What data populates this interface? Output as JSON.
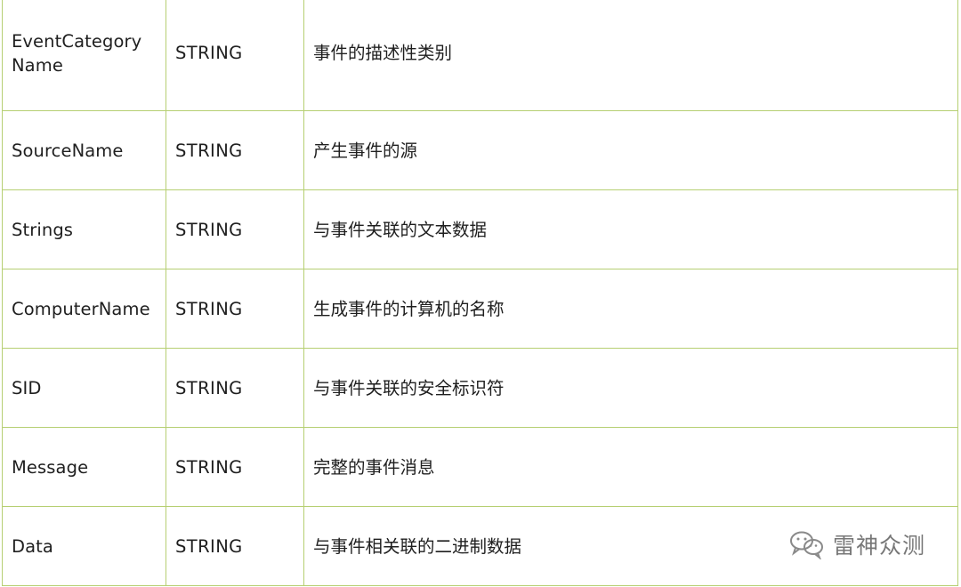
{
  "table": {
    "rows": [
      {
        "name": "EventCategoryName",
        "type": "STRING",
        "description": "事件的描述性类别"
      },
      {
        "name": "SourceName",
        "type": "STRING",
        "description": "产生事件的源"
      },
      {
        "name": "Strings",
        "type": "STRING",
        "description": "与事件关联的文本数据"
      },
      {
        "name": "ComputerName",
        "type": "STRING",
        "description": "生成事件的计算机的名称"
      },
      {
        "name": "SID",
        "type": "STRING",
        "description": "与事件关联的安全标识符"
      },
      {
        "name": "Message",
        "type": "STRING",
        "description": "完整的事件消息"
      },
      {
        "name": "Data",
        "type": "STRING",
        "description": "与事件相关联的二进制数据"
      }
    ]
  },
  "watermark": {
    "icon": "wechat-icon",
    "text": "雷神众测"
  },
  "colors": {
    "border": "#b6cf72",
    "text": "#1f1f1f",
    "watermark": "#777777"
  }
}
